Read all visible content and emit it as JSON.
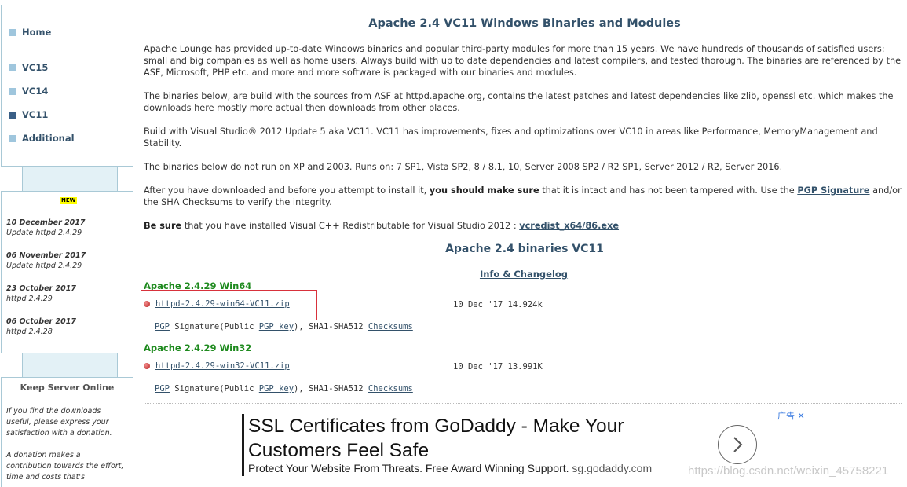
{
  "nav": {
    "items": [
      {
        "label": "Home"
      },
      {
        "label": "VC15"
      },
      {
        "label": "VC14"
      },
      {
        "label": "VC11"
      },
      {
        "label": "Additional"
      }
    ]
  },
  "news": {
    "badge": "NEW",
    "entries": [
      {
        "date": "10 December 2017",
        "text": "Update httpd 2.4.29"
      },
      {
        "date": "06 November 2017",
        "text": "Update httpd 2.4.29"
      },
      {
        "date": "23 October 2017",
        "text": "httpd 2.4.29"
      },
      {
        "date": "06 October 2017",
        "text": "httpd 2.4.28"
      }
    ]
  },
  "keep": {
    "title": "Keep Server Online",
    "p1": "If you find the downloads useful, please express your satisfaction with a donation.",
    "p2": "A donation makes a contribution towards the effort, time and costs that's"
  },
  "main": {
    "title": "Apache 2.4 VC11 Windows Binaries and Modules",
    "p1": "Apache Lounge has provided up-to-date Windows binaries and popular third-party modules for more than 15 years. We have hundreds of thousands of satisfied users: small and big companies as well as home users. Always build with up to date dependencies and latest compilers, and tested thorough. The binaries are referenced by the ASF, Microsoft, PHP etc. and more and more software is packaged with our binaries and modules.",
    "p2": "The binaries below, are build with the sources from ASF at httpd.apache.org, contains the latest patches and latest dependencies like zlib, openssl etc. which makes the downloads here mostly more actual then downloads from other places.",
    "p3": "Build with Visual Studio® 2012 Update 5 aka VC11. VC11 has improvements, fixes and optimizations over VC10 in areas like Performance, MemoryManagement and Stability.",
    "p4": "The binaries below do not run on XP and 2003. Runs on: 7 SP1, Vista SP2, 8 / 8.1, 10, Server 2008 SP2 / R2 SP1, Server 2012 / R2, Server 2016.",
    "p5a": "After you have downloaded and before you attempt to install it,",
    "p5b": "you should make sure",
    "p5c": "that it is intact and has not been tampered with. Use the",
    "p5link": "PGP Signature",
    "p5d": "and/or the SHA Checksums to verify the integrity.",
    "p6a": "Be sure",
    "p6b": "that you have installed Visual C++ Redistributable for Visual Studio 2012 :",
    "p6link": "vcredist_x64/86.exe",
    "subtitle": "Apache 2.4 binaries VC11",
    "info_link": "Info & Changelog"
  },
  "downloads": [
    {
      "heading": "Apache 2.4.29 Win64",
      "file": "httpd-2.4.29-win64-VC11.zip",
      "meta": "10 Dec '17 14.924k",
      "sig_pgp": "PGP",
      "sig_text1": "Signature(Public",
      "sig_key": "PGP key",
      "sig_text2": "), SHA1-SHA512",
      "sig_checksums": "Checksums"
    },
    {
      "heading": "Apache 2.4.29 Win32",
      "file": "httpd-2.4.29-win32-VC11.zip",
      "meta": "10 Dec '17 13.991K",
      "sig_pgp": "PGP",
      "sig_text1": "Signature(Public",
      "sig_key": "PGP key",
      "sig_text2": "), SHA1-SHA512",
      "sig_checksums": "Checksums"
    }
  ],
  "ad": {
    "headline1": "SSL Certificates from GoDaddy - Make Your",
    "headline2": "Customers Feel Safe",
    "desc": "Protect Your Website From Threats. Free Award Winning Support.",
    "domain": "sg.godaddy.com",
    "marker": "广告 ✕",
    "arrow_icon": "chevron-right-icon"
  },
  "watermark": "https://blog.csdn.net/weixin_45758221",
  "colors": {
    "accent": "#33516a",
    "green_heading": "#1e8a1e",
    "highlight_border": "#d8313b",
    "sidebar_border": "#a9c9d6"
  }
}
